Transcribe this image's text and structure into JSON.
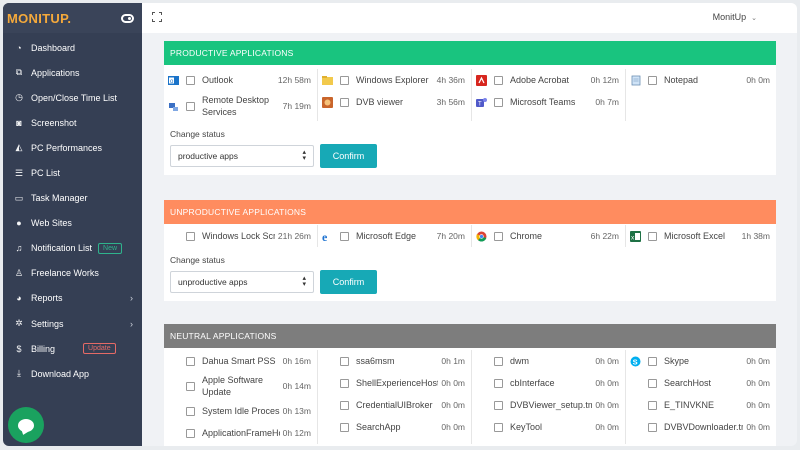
{
  "brand": {
    "name": "MONITUP."
  },
  "sidebar": {
    "items": [
      {
        "label": "Dashboard",
        "icon": "dashboard-icon"
      },
      {
        "label": "Applications",
        "icon": "applications-icon"
      },
      {
        "label": "Open/Close Time List",
        "icon": "clock-icon"
      },
      {
        "label": "Screenshot",
        "icon": "camera-icon"
      },
      {
        "label": "PC Performances",
        "icon": "area-chart-icon"
      },
      {
        "label": "PC List",
        "icon": "list-icon"
      },
      {
        "label": "Task Manager",
        "icon": "monitor-icon"
      },
      {
        "label": "Web Sites",
        "icon": "globe-icon"
      },
      {
        "label": "Notification List",
        "icon": "bell-icon",
        "badge": "New"
      },
      {
        "label": "Freelance Works",
        "icon": "user-icon"
      },
      {
        "label": "Reports",
        "icon": "pie-chart-icon",
        "chevron": true
      },
      {
        "label": "Settings",
        "icon": "gear-icon",
        "chevron": true
      },
      {
        "label": "Billing",
        "icon": "dollar-icon",
        "badge": "Update"
      },
      {
        "label": "Download App",
        "icon": "download-icon"
      }
    ]
  },
  "topbar": {
    "user": "MonitUp"
  },
  "productive": {
    "title": "PRODUCTIVE APPLICATIONS",
    "columns": [
      [
        {
          "name": "Outlook",
          "time": "12h 58m",
          "icon": "outlook-icon"
        },
        {
          "name": "Remote Desktop Services",
          "time": "7h 19m",
          "icon": "remote-desktop-icon",
          "tall": true
        }
      ],
      [
        {
          "name": "Windows Explorer",
          "time": "4h 36m",
          "icon": "folder-icon"
        },
        {
          "name": "DVB viewer",
          "time": "3h 56m",
          "icon": "dvb-viewer-icon"
        }
      ],
      [
        {
          "name": "Adobe Acrobat",
          "time": "0h 12m",
          "icon": "acrobat-icon"
        },
        {
          "name": "Microsoft Teams",
          "time": "0h 7m",
          "icon": "teams-icon"
        }
      ],
      [
        {
          "name": "Notepad",
          "time": "0h 0m",
          "icon": "notepad-icon"
        }
      ]
    ],
    "change_label": "Change status",
    "select_value": "productive apps",
    "confirm": "Confirm"
  },
  "unproductive": {
    "title": "UNPRODUCTIVE APPLICATIONS",
    "columns": [
      [
        {
          "name": "Windows Lock Screen",
          "time": "21h 26m",
          "icon": ""
        }
      ],
      [
        {
          "name": "Microsoft Edge",
          "time": "7h 20m",
          "icon": "edge-icon"
        }
      ],
      [
        {
          "name": "Chrome",
          "time": "6h 22m",
          "icon": "chrome-icon"
        }
      ],
      [
        {
          "name": "Microsoft Excel",
          "time": "1h 38m",
          "icon": "excel-icon"
        }
      ]
    ],
    "change_label": "Change status",
    "select_value": "unproductive apps",
    "confirm": "Confirm"
  },
  "neutral": {
    "title": "NEUTRAL APPLICATIONS",
    "columns": [
      [
        {
          "name": "Dahua Smart PSS",
          "time": "0h 16m",
          "icon": ""
        },
        {
          "name": "Apple Software Update",
          "time": "0h 14m",
          "icon": "",
          "tall": true
        },
        {
          "name": "System Idle Process",
          "time": "0h 13m",
          "icon": ""
        },
        {
          "name": "ApplicationFrameHost",
          "time": "0h 12m",
          "icon": ""
        }
      ],
      [
        {
          "name": "ssa6msm",
          "time": "0h 1m",
          "icon": ""
        },
        {
          "name": "ShellExperienceHost",
          "time": "0h 0m",
          "icon": ""
        },
        {
          "name": "CredentialUIBroker",
          "time": "0h 0m",
          "icon": ""
        },
        {
          "name": "SearchApp",
          "time": "0h 0m",
          "icon": ""
        }
      ],
      [
        {
          "name": "dwm",
          "time": "0h 0m",
          "icon": ""
        },
        {
          "name": "cbInterface",
          "time": "0h 0m",
          "icon": ""
        },
        {
          "name": "DVBViewer_setup.tmp",
          "time": "0h 0m",
          "icon": ""
        },
        {
          "name": "KeyTool",
          "time": "0h 0m",
          "icon": ""
        }
      ],
      [
        {
          "name": "Skype",
          "time": "0h 0m",
          "icon": "skype-icon"
        },
        {
          "name": "SearchHost",
          "time": "0h 0m",
          "icon": ""
        },
        {
          "name": "E_TINVKNE",
          "time": "0h 0m",
          "icon": ""
        },
        {
          "name": "DVBVDownloader.tmp",
          "time": "0h 0m",
          "icon": ""
        }
      ]
    ]
  },
  "colors": {
    "productive": "#19c47f",
    "unproductive": "#ff8c5f",
    "neutral": "#7d7d7d",
    "accent": "#17a9b6",
    "sidebar": "#353f54"
  }
}
